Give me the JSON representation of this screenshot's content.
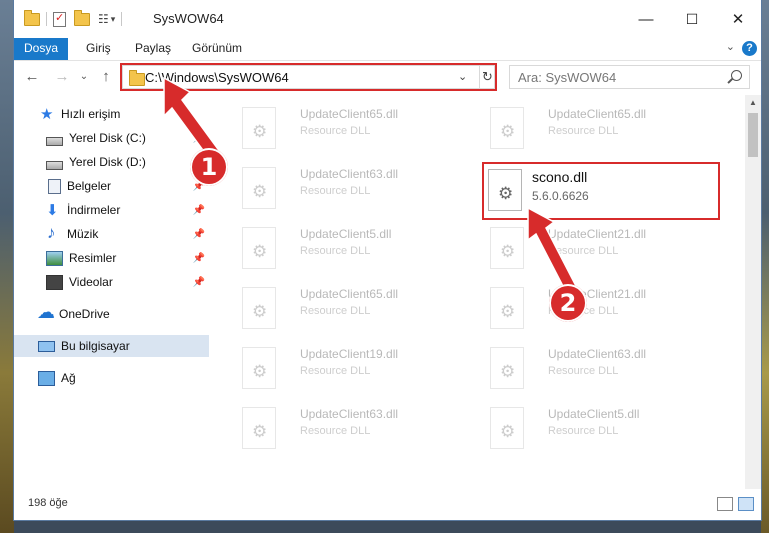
{
  "window": {
    "title": "SysWOW64",
    "controls": {
      "minimize": "—",
      "maximize": "☐",
      "close": "✕"
    }
  },
  "ribbon": {
    "tabs": [
      "Dosya",
      "Giriş",
      "Paylaş",
      "Görünüm"
    ],
    "collapse": "⌄",
    "help": "?"
  },
  "nav_buttons": {
    "back": "←",
    "forward": "→",
    "recent": "⌄",
    "up": "↑"
  },
  "address": {
    "path": "C:\\Windows\\SysWOW64",
    "dropdown": "⌄",
    "refresh": "↻"
  },
  "search": {
    "placeholder": "Ara: SysWOW64"
  },
  "sidebar": {
    "items": [
      {
        "label": "Hızlı erişim",
        "icon": "star-icon"
      },
      {
        "label": "Yerel Disk (C:)",
        "icon": "drive-icon",
        "pinned": true
      },
      {
        "label": "Yerel Disk (D:)",
        "icon": "drive-icon",
        "pinned": true
      },
      {
        "label": "Belgeler",
        "icon": "documents-icon",
        "pinned": true
      },
      {
        "label": "İndirmeler",
        "icon": "downloads-icon",
        "pinned": true
      },
      {
        "label": "Müzik",
        "icon": "music-icon",
        "pinned": true
      },
      {
        "label": "Resimler",
        "icon": "pictures-icon",
        "pinned": true
      },
      {
        "label": "Videolar",
        "icon": "videos-icon",
        "pinned": true
      },
      {
        "label": "OneDrive",
        "icon": "cloud-icon"
      },
      {
        "label": "Bu bilgisayar",
        "icon": "computer-icon",
        "selected": true
      },
      {
        "label": "Ağ",
        "icon": "network-icon"
      }
    ]
  },
  "files": {
    "left": [
      {
        "name": "UpdateClient65.dll",
        "desc": "Resource DLL"
      },
      {
        "name": "UpdateClient63.dll",
        "desc": "Resource DLL"
      },
      {
        "name": "UpdateClient5.dll",
        "desc": "Resource DLL"
      },
      {
        "name": "UpdateClient65.dll",
        "desc": "Resource DLL"
      },
      {
        "name": "UpdateClient19.dll",
        "desc": "Resource DLL"
      },
      {
        "name": "UpdateClient63.dll",
        "desc": "Resource DLL"
      }
    ],
    "right": [
      {
        "name": "UpdateClient65.dll",
        "desc": "Resource DLL"
      },
      {
        "name": "scono.dll",
        "desc": "5.6.0.6626"
      },
      {
        "name": "UpdateClient21.dll",
        "desc": "Resource DLL"
      },
      {
        "name": "UpdateClient21.dll",
        "desc": "Resource DLL"
      },
      {
        "name": "UpdateClient63.dll",
        "desc": "Resource DLL"
      },
      {
        "name": "UpdateClient5.dll",
        "desc": "Resource DLL"
      }
    ]
  },
  "status": {
    "count": "198 öğe"
  },
  "annotations": {
    "step1": "1",
    "step2": "2",
    "color": "#d72b2b"
  }
}
